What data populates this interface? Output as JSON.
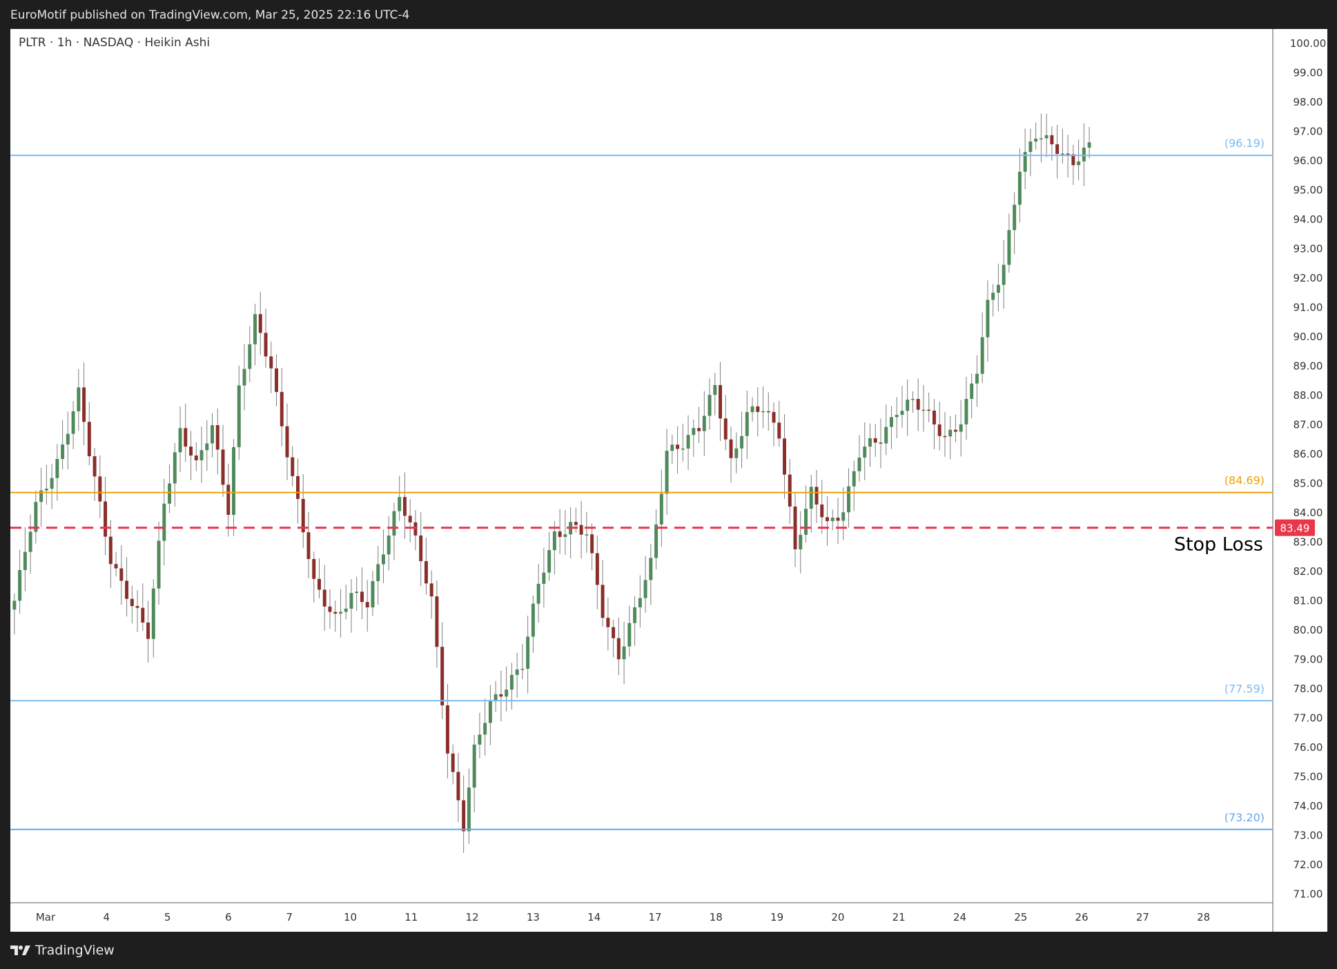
{
  "header": {
    "published": "EuroMotif published on TradingView.com, Mar 25, 2025 22:16 UTC-4"
  },
  "legend": {
    "symbol": "PLTR · 1h · NASDAQ · Heikin Ashi"
  },
  "footer": {
    "brand": "TradingView"
  },
  "colors": {
    "up": "#4e8a5a",
    "down": "#8a2e2a",
    "wick": "#7d7d7d",
    "support": "#7dbaf0",
    "support_strong": "#62a8ea",
    "orange": "#f0a000",
    "stop": "#e8374b"
  },
  "chart_data": {
    "type": "candlestick",
    "ylim": [
      70.7,
      100.5
    ],
    "y_ticks": [
      "100.00",
      "99.00",
      "98.00",
      "97.00",
      "96.00",
      "95.00",
      "94.00",
      "93.00",
      "92.00",
      "91.00",
      "90.00",
      "89.00",
      "88.00",
      "87.00",
      "86.00",
      "85.00",
      "84.00",
      "83.00",
      "82.00",
      "81.00",
      "80.00",
      "79.00",
      "78.00",
      "77.00",
      "76.00",
      "75.00",
      "74.00",
      "73.00",
      "72.00",
      "71.00"
    ],
    "x_labels": [
      "Mar",
      "4",
      "5",
      "6",
      "7",
      "10",
      "11",
      "12",
      "13",
      "14",
      "17",
      "18",
      "19",
      "20",
      "21",
      "24",
      "25",
      "26",
      "27",
      "28"
    ],
    "levels": [
      {
        "label": "(96.19)",
        "value": 96.19,
        "color": "#7dbaf0",
        "style": "solid"
      },
      {
        "label": "(84.69)",
        "value": 84.69,
        "color": "#f0a000",
        "style": "solid"
      },
      {
        "label": "(77.59)",
        "value": 77.59,
        "color": "#7dbaf0",
        "style": "solid"
      },
      {
        "label": "(73.20)",
        "value": 73.2,
        "color": "#62a8ea",
        "style": "solid"
      }
    ],
    "stop_loss": {
      "value": 83.49,
      "label": "83.49",
      "text": "Stop Loss"
    },
    "series": [
      {
        "waypoints": [
          [
            0,
            81.0
          ],
          [
            4,
            84.2
          ],
          [
            8,
            85.8
          ],
          [
            12,
            88.0
          ],
          [
            14,
            86.0
          ],
          [
            18,
            82.5
          ],
          [
            22,
            80.8
          ],
          [
            25,
            79.8
          ],
          [
            28,
            84.5
          ],
          [
            31,
            86.8
          ],
          [
            34,
            85.5
          ],
          [
            37,
            87.0
          ],
          [
            40,
            84.2
          ],
          [
            42,
            88.2
          ],
          [
            45,
            90.5
          ],
          [
            48,
            89.0
          ],
          [
            52,
            85.2
          ],
          [
            56,
            81.5
          ],
          [
            60,
            80.5
          ],
          [
            63,
            81.2
          ],
          [
            66,
            80.8
          ],
          [
            69,
            82.8
          ],
          [
            72,
            84.6
          ],
          [
            74,
            83.6
          ],
          [
            78,
            81.0
          ],
          [
            81,
            76.0
          ],
          [
            84,
            73.3
          ],
          [
            86,
            75.8
          ],
          [
            89,
            77.5
          ],
          [
            92,
            78.2
          ],
          [
            95,
            78.8
          ],
          [
            98,
            81.5
          ],
          [
            101,
            83.3
          ],
          [
            104,
            83.6
          ],
          [
            107,
            83.2
          ],
          [
            110,
            80.6
          ],
          [
            113,
            79.2
          ],
          [
            116,
            80.6
          ],
          [
            119,
            82.2
          ],
          [
            122,
            86.2
          ],
          [
            125,
            86.4
          ],
          [
            128,
            86.8
          ],
          [
            131,
            88.3
          ],
          [
            134,
            85.8
          ],
          [
            137,
            87.3
          ],
          [
            140,
            87.5
          ],
          [
            143,
            86.8
          ],
          [
            146,
            82.8
          ],
          [
            149,
            84.6
          ],
          [
            152,
            83.6
          ],
          [
            155,
            84.2
          ],
          [
            158,
            86.0
          ],
          [
            162,
            86.5
          ],
          [
            165,
            87.6
          ],
          [
            168,
            87.8
          ],
          [
            171,
            87.2
          ],
          [
            174,
            86.6
          ],
          [
            177,
            87.2
          ],
          [
            180,
            88.8
          ],
          [
            182,
            91.0
          ],
          [
            185,
            92.5
          ],
          [
            188,
            95.8
          ],
          [
            191,
            96.8
          ],
          [
            195,
            96.5
          ],
          [
            198,
            96.0
          ],
          [
            201,
            96.4
          ]
        ]
      }
    ]
  }
}
